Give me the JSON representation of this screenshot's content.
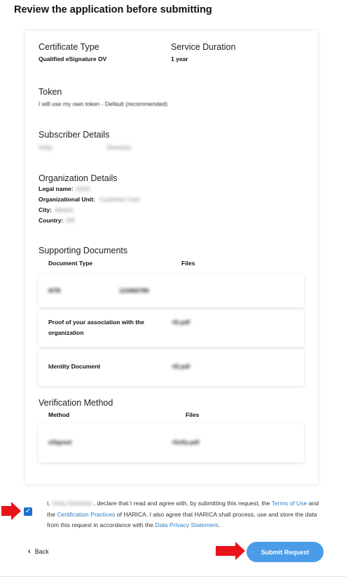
{
  "page_title": "Review the application before submitting",
  "certificate": {
    "type_label": "Certificate Type",
    "type_value": "Qualified eSignature OV",
    "duration_label": "Service Duration",
    "duration_value": "1 year"
  },
  "token": {
    "label": "Token",
    "value": "I will use my own token - Default (recommended)"
  },
  "subscriber": {
    "label": "Subscriber Details",
    "first_name": "Vicky",
    "last_name": "Demertzi"
  },
  "organization": {
    "label": "Organization Details",
    "legal_name_label": "Legal name:",
    "legal_name_value": "GSIS",
    "unit_label": "Organizational Unit:",
    "unit_value": "Customer Care",
    "city_label": "City:",
    "city_value": "Athens",
    "country_label": "Country:",
    "country_value": "GR"
  },
  "supporting_documents": {
    "label": "Supporting Documents",
    "col_type": "Document Type",
    "col_files": "Files",
    "rows": [
      {
        "type": "NTR",
        "file": "123456789"
      },
      {
        "type": "Proof of your association with the organization",
        "file": "•f2.pdf"
      },
      {
        "type": "Identity Document",
        "file": "•f2.pdf"
      }
    ]
  },
  "verification": {
    "label": "Verification Method",
    "col_method": "Method",
    "col_files": "Files",
    "rows": [
      {
        "method": "eSigned",
        "file": "•Sofia.pdf"
      }
    ]
  },
  "consent": {
    "prefix": "I, ",
    "name": "Vicky Demertzi",
    "text1": " , declare that I read and agree with, by submitting this request, the ",
    "terms_link": "Terms of Use",
    "text2": " and the ",
    "cp_link": "Certification Practices",
    "text3": " of HARICA. I also agree that HARICA shall process, use and store the data from this request in accordance with the ",
    "privacy_link": "Data Privacy Statement",
    "text4": "."
  },
  "actions": {
    "back_label": "Back",
    "submit_label": "Submit Request"
  },
  "colors": {
    "accent": "#4a9ce8",
    "link": "#2b7fc9",
    "annotation_arrow": "#e8131b"
  }
}
